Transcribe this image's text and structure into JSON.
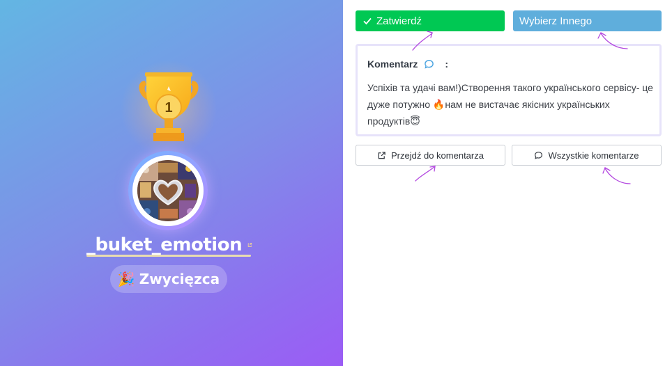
{
  "winner": {
    "rank": "1",
    "username": "_buket_emotion",
    "badge_label": "Zwycięzca",
    "badge_emoji": "🎉"
  },
  "actions": {
    "confirm_label": "Zatwierdź",
    "choose_other_label": "Wybierz Innego"
  },
  "comment": {
    "title": "Komentarz",
    "colon": ":",
    "text": "Успіхів та удачі вам!)Створення такого українського сервісу- це дуже потужно 🔥нам не вистачає якісних українських продуктів😇"
  },
  "links": {
    "goto_comment_label": "Przejdź do komentarza",
    "all_comments_label": "Wszystkie komentarze"
  },
  "icons": [
    "trophy-icon",
    "external-link-icon",
    "check-icon",
    "speech-bubble-icon",
    "party-popper-icon"
  ],
  "colors": {
    "confirm": "#00c853",
    "choose_other": "#5faedc",
    "annotation_arrows": "#b44ae0"
  }
}
